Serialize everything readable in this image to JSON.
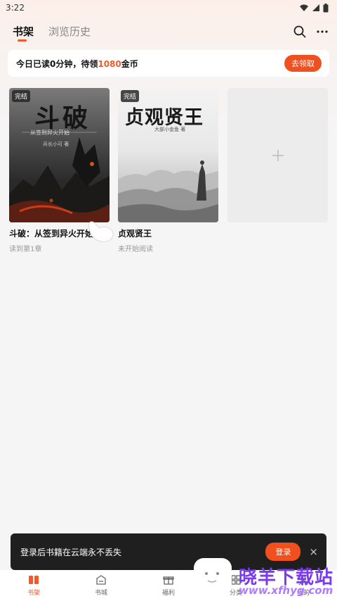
{
  "status": {
    "time": "3:22"
  },
  "header": {
    "tabs": [
      {
        "label": "书架",
        "active": true
      },
      {
        "label": "浏览历史",
        "active": false
      }
    ],
    "icons": [
      "search-icon",
      "more-icon"
    ]
  },
  "banner": {
    "text_prefix": "今日已读0分钟，待领",
    "coins": "1080",
    "text_suffix": "金币",
    "button": "去领取"
  },
  "books": [
    {
      "title": "斗破：从签到异火开始",
      "progress": "读到第1章",
      "badge": "完结",
      "cover_title": "斗破",
      "cover_sub": "从签到异火开始",
      "cover_author": "兵长小可 著"
    },
    {
      "title": "贞观贤王",
      "progress": "未开始阅读",
      "badge": "完结",
      "cover_title": "贞观贤王",
      "cover_author": "大部小金鱼 著"
    }
  ],
  "add_card": {
    "icon": "plus-icon"
  },
  "login_toast": {
    "text": "登录后书籍在云端永不丢失",
    "button": "登录",
    "close": "×"
  },
  "bottom_nav": [
    {
      "label": "书架",
      "icon": "bookshelf-icon",
      "active": true
    },
    {
      "label": "书城",
      "icon": "bookstore-icon",
      "active": false
    },
    {
      "label": "福利",
      "icon": "gift-icon",
      "active": false
    },
    {
      "label": "分类",
      "icon": "category-icon",
      "active": false
    },
    {
      "label": "我的",
      "icon": "profile-icon",
      "active": false
    }
  ],
  "watermark": {
    "name": "晓羊下载站",
    "url": "www.xfhyg.com"
  },
  "colors": {
    "accent": "#f25a2a",
    "toast_bg": "#1f1f1f",
    "background": "#f5f5f5"
  }
}
